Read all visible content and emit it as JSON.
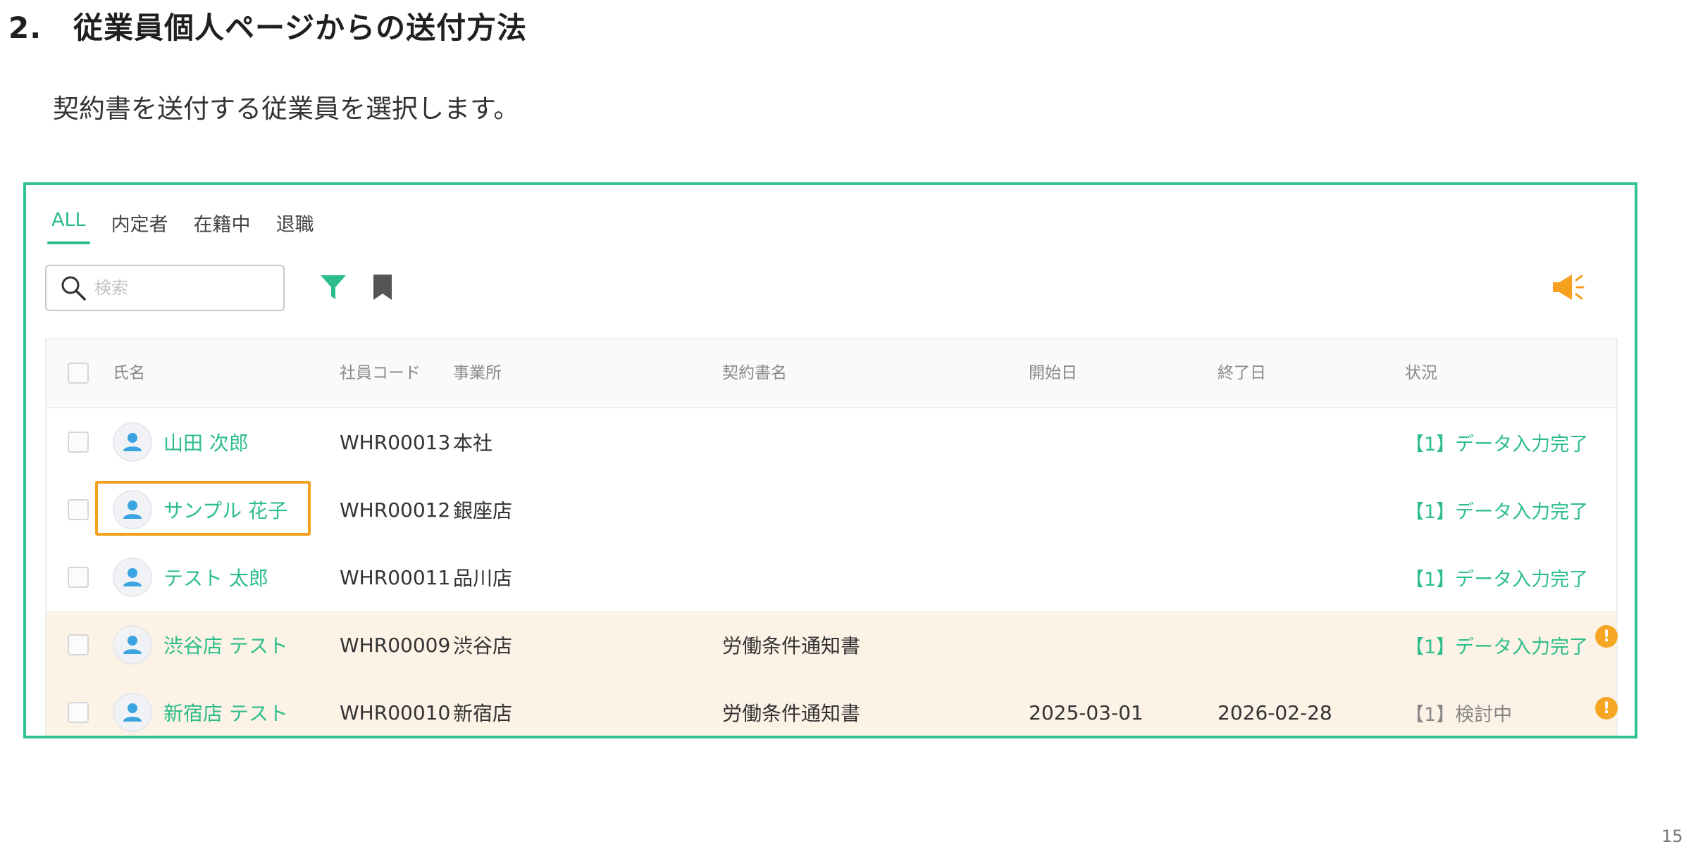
{
  "heading": {
    "number": "2.",
    "title": "従業員個人ページからの送付方法"
  },
  "instruction": "契約書を送付する従業員を選択します。",
  "tabs": [
    {
      "label": "ALL",
      "active": true
    },
    {
      "label": "内定者",
      "active": false
    },
    {
      "label": "在籍中",
      "active": false
    },
    {
      "label": "退職",
      "active": false
    }
  ],
  "search": {
    "placeholder": "検索",
    "value": ""
  },
  "icons": {
    "search": "search-icon",
    "filter": "filter-icon",
    "bookmark": "bookmark-icon",
    "announce": "megaphone-icon",
    "avatar": "user-avatar-icon",
    "alert": "exclamation-icon"
  },
  "table": {
    "headers": {
      "name": "氏名",
      "code": "社員コード",
      "office": "事業所",
      "contract": "契約書名",
      "start": "開始日",
      "end": "終了日",
      "status": "状況"
    },
    "rows": [
      {
        "name": "山田 次郎",
        "code": "WHR00013",
        "office": "本社",
        "contract": "",
        "start": "",
        "end": "",
        "status": "【1】データ入力完了",
        "status_type": "green",
        "alert": false
      },
      {
        "name": "サンプル 花子",
        "code": "WHR00012",
        "office": "銀座店",
        "contract": "",
        "start": "",
        "end": "",
        "status": "【1】データ入力完了",
        "status_type": "green",
        "alert": false
      },
      {
        "name": "テスト 太郎",
        "code": "WHR00011",
        "office": "品川店",
        "contract": "",
        "start": "",
        "end": "",
        "status": "【1】データ入力完了",
        "status_type": "green",
        "alert": false
      },
      {
        "name": "渋谷店 テスト",
        "code": "WHR00009",
        "office": "渋谷店",
        "contract": "労働条件通知書",
        "start": "",
        "end": "",
        "status": "【1】データ入力完了",
        "status_type": "green",
        "alert": true,
        "alert_mark": "!"
      },
      {
        "name": "新宿店 テスト",
        "code": "WHR00010",
        "office": "新宿店",
        "contract": "労働条件通知書",
        "start": "2025-03-01",
        "end": "2026-02-28",
        "status": "【1】検討中",
        "status_type": "muted",
        "alert": true,
        "alert_mark": "!"
      }
    ]
  },
  "colors": {
    "accent": "#2dbd8b",
    "frame": "#2dc48f",
    "highlight": "#f5a01e",
    "warn_row": "#fdf2e6",
    "alert": "#f5a623"
  },
  "page_number": "15"
}
